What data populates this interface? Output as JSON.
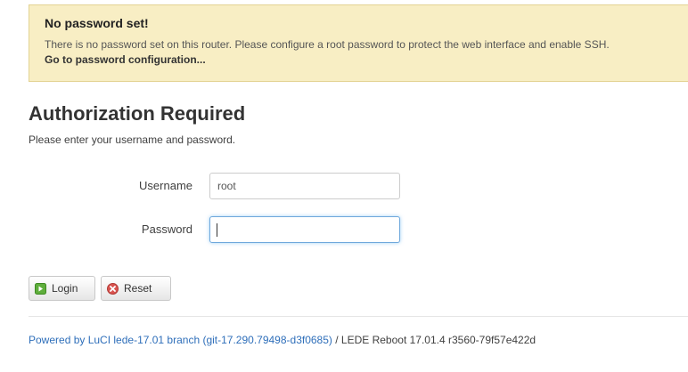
{
  "alert": {
    "title": "No password set!",
    "message": "There is no password set on this router. Please configure a root password to protect the web interface and enable SSH.",
    "link": "Go to password configuration..."
  },
  "auth": {
    "heading": "Authorization Required",
    "subheading": "Please enter your username and password."
  },
  "form": {
    "username_label": "Username",
    "username_value": "root",
    "password_label": "Password",
    "password_value": ""
  },
  "buttons": {
    "login": "Login",
    "reset": "Reset"
  },
  "footer": {
    "powered_link": "Powered by LuCI lede-17.01 branch (git-17.290.79498-d3f0685)",
    "version_text": " / LEDE Reboot 17.01.4 r3560-79f57e422d"
  },
  "icons": {
    "login": "login-icon",
    "reset": "reset-icon"
  },
  "colors": {
    "alert_bg": "#f8eec4",
    "link": "#2f6fba",
    "focus": "#6fa8dc"
  }
}
